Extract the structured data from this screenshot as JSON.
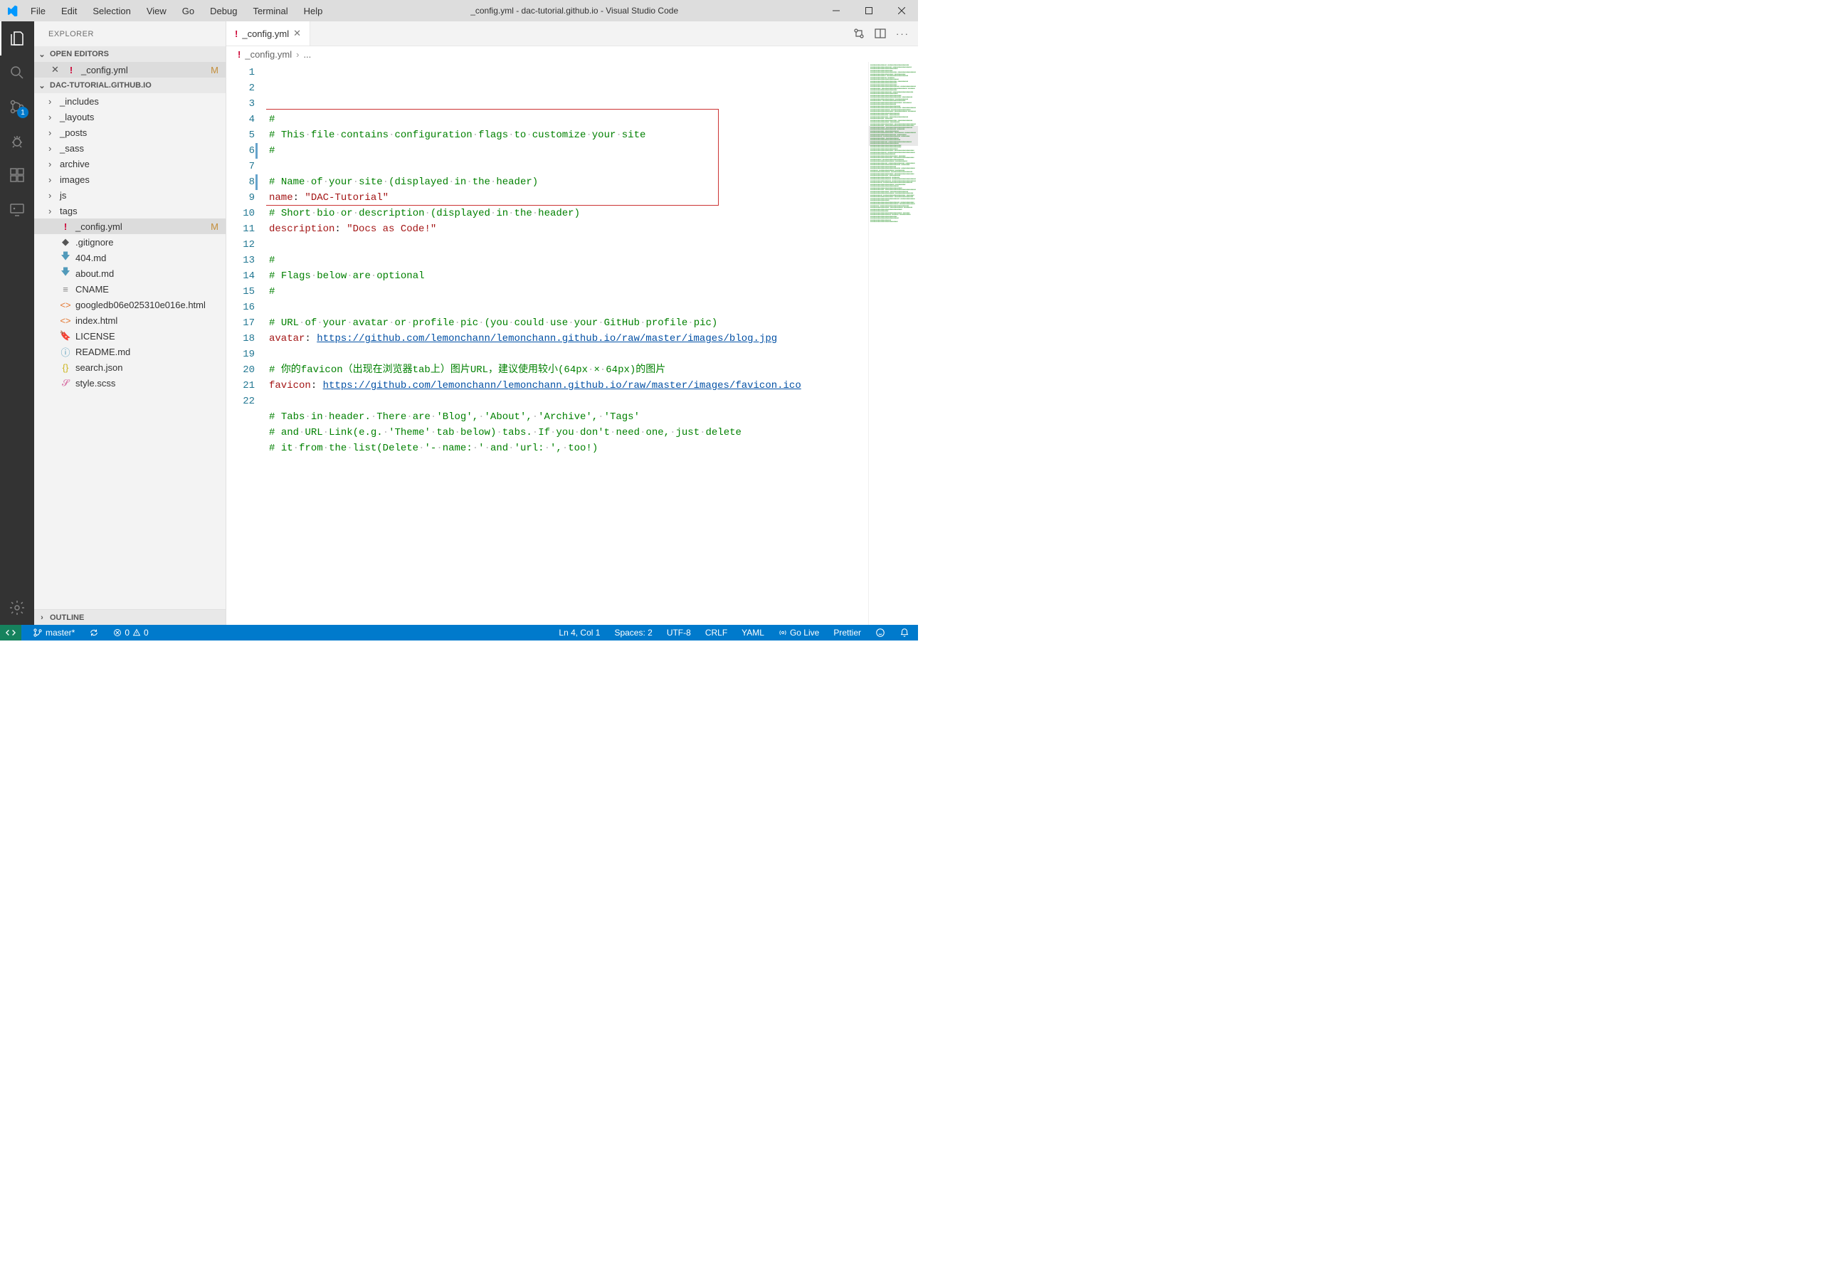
{
  "titlebar": {
    "title": "_config.yml - dac-tutorial.github.io - Visual Studio Code",
    "menu": [
      "File",
      "Edit",
      "Selection",
      "View",
      "Go",
      "Debug",
      "Terminal",
      "Help"
    ]
  },
  "activitybar": {
    "scm_badge": "1"
  },
  "sidebar": {
    "title": "EXPLORER",
    "open_editors_label": "OPEN EDITORS",
    "open_editors": [
      {
        "name": "_config.yml",
        "modified": "M",
        "icon": "yaml"
      }
    ],
    "workspace_label": "DAC-TUTORIAL.GITHUB.IO",
    "tree": [
      {
        "name": "_includes",
        "type": "folder"
      },
      {
        "name": "_layouts",
        "type": "folder"
      },
      {
        "name": "_posts",
        "type": "folder"
      },
      {
        "name": "_sass",
        "type": "folder"
      },
      {
        "name": "archive",
        "type": "folder"
      },
      {
        "name": "images",
        "type": "folder"
      },
      {
        "name": "js",
        "type": "folder"
      },
      {
        "name": "tags",
        "type": "folder"
      },
      {
        "name": "_config.yml",
        "type": "file",
        "icon": "yaml",
        "modified": "M",
        "selected": true
      },
      {
        "name": ".gitignore",
        "type": "file",
        "icon": "gitignore"
      },
      {
        "name": "404.md",
        "type": "file",
        "icon": "md"
      },
      {
        "name": "about.md",
        "type": "file",
        "icon": "md"
      },
      {
        "name": "CNAME",
        "type": "file",
        "icon": "txt"
      },
      {
        "name": "googledb06e025310e016e.html",
        "type": "file",
        "icon": "html"
      },
      {
        "name": "index.html",
        "type": "file",
        "icon": "html"
      },
      {
        "name": "LICENSE",
        "type": "file",
        "icon": "license"
      },
      {
        "name": "README.md",
        "type": "file",
        "icon": "info"
      },
      {
        "name": "search.json",
        "type": "file",
        "icon": "json"
      },
      {
        "name": "style.scss",
        "type": "file",
        "icon": "scss"
      }
    ],
    "outline_label": "OUTLINE"
  },
  "editor": {
    "tab_name": "_config.yml",
    "breadcrumb_file": "_config.yml",
    "breadcrumb_tail": "..."
  },
  "code_lines": [
    {
      "n": 1,
      "segs": [
        {
          "t": "# ",
          "c": "cmt"
        }
      ]
    },
    {
      "n": 2,
      "segs": [
        {
          "t": "# ",
          "c": "cmt"
        },
        {
          "t": "This·file·contains·configuration·flags·to·customize·your·site",
          "c": "cmt",
          "ws": true
        }
      ]
    },
    {
      "n": 3,
      "segs": [
        {
          "t": "#",
          "c": "cmt"
        }
      ]
    },
    {
      "n": 4,
      "segs": []
    },
    {
      "n": 5,
      "segs": [
        {
          "t": "# ",
          "c": "cmt"
        },
        {
          "t": "Name·of·your·site·(displayed·in·the·header)",
          "c": "cmt",
          "ws": true
        }
      ]
    },
    {
      "n": 6,
      "dirty": true,
      "segs": [
        {
          "t": "name",
          "c": "key"
        },
        {
          "t": ":"
        },
        {
          "t": " "
        },
        {
          "t": "\"DAC-Tutorial\"",
          "c": "key"
        }
      ]
    },
    {
      "n": 7,
      "segs": [
        {
          "t": "# ",
          "c": "cmt"
        },
        {
          "t": "Short·bio·or·description·(displayed·in·the·header)",
          "c": "cmt",
          "ws": true
        }
      ]
    },
    {
      "n": 8,
      "dirty": true,
      "segs": [
        {
          "t": "description",
          "c": "key"
        },
        {
          "t": ":"
        },
        {
          "t": " "
        },
        {
          "t": "\"Docs as Code!\"",
          "c": "key"
        }
      ]
    },
    {
      "n": 9,
      "segs": []
    },
    {
      "n": 10,
      "segs": [
        {
          "t": "#",
          "c": "cmt"
        }
      ]
    },
    {
      "n": 11,
      "segs": [
        {
          "t": "# ",
          "c": "cmt"
        },
        {
          "t": "Flags·below·are·optional",
          "c": "cmt",
          "ws": true
        }
      ]
    },
    {
      "n": 12,
      "segs": [
        {
          "t": "#",
          "c": "cmt"
        }
      ]
    },
    {
      "n": 13,
      "segs": []
    },
    {
      "n": 14,
      "segs": [
        {
          "t": "# ",
          "c": "cmt"
        },
        {
          "t": "URL·of·your·avatar·or·profile·pic·(you·could·use·your·GitHub·profile·pic)",
          "c": "cmt",
          "ws": true
        }
      ]
    },
    {
      "n": 15,
      "segs": [
        {
          "t": "avatar",
          "c": "key"
        },
        {
          "t": ":"
        },
        {
          "t": " "
        },
        {
          "t": "https://github.com/lemonchann/lemonchann.github.io/raw/master/images/blog.jpg",
          "c": "url"
        }
      ]
    },
    {
      "n": 16,
      "segs": []
    },
    {
      "n": 17,
      "segs": [
        {
          "t": "# ",
          "c": "cmt"
        },
        {
          "t": "你的favicon（出现在浏览器tab上）图片URL，建议使用较小(64px·×·64px)的图片",
          "c": "cmt",
          "ws": true
        }
      ]
    },
    {
      "n": 18,
      "segs": [
        {
          "t": "favicon",
          "c": "key"
        },
        {
          "t": ":"
        },
        {
          "t": " "
        },
        {
          "t": "https://github.com/lemonchann/lemonchann.github.io/raw/master/images/favicon.ico",
          "c": "url"
        }
      ]
    },
    {
      "n": 19,
      "segs": []
    },
    {
      "n": 20,
      "segs": [
        {
          "t": "# ",
          "c": "cmt"
        },
        {
          "t": "Tabs·in·header.·There·are·'Blog',·'About',·'Archive',·'Tags'",
          "c": "cmt",
          "ws": true
        }
      ]
    },
    {
      "n": 21,
      "segs": [
        {
          "t": "# ",
          "c": "cmt"
        },
        {
          "t": "and·URL·Link(e.g.·'Theme'·tab·below)·tabs.·If·you·don't·need·one,·just·delete",
          "c": "cmt",
          "ws": true
        }
      ]
    },
    {
      "n": 22,
      "segs": [
        {
          "t": "# ",
          "c": "cmt"
        },
        {
          "t": "it·from·the·list(Delete·'-·name:·'·and·'url:·',·too!)",
          "c": "cmt",
          "ws": true
        }
      ]
    }
  ],
  "statusbar": {
    "branch": "master*",
    "errors": "0",
    "warnings": "0",
    "ln_col": "Ln 4, Col 1",
    "spaces": "Spaces: 2",
    "encoding": "UTF-8",
    "eol": "CRLF",
    "lang": "YAML",
    "golive": "Go Live",
    "prettier": "Prettier"
  }
}
